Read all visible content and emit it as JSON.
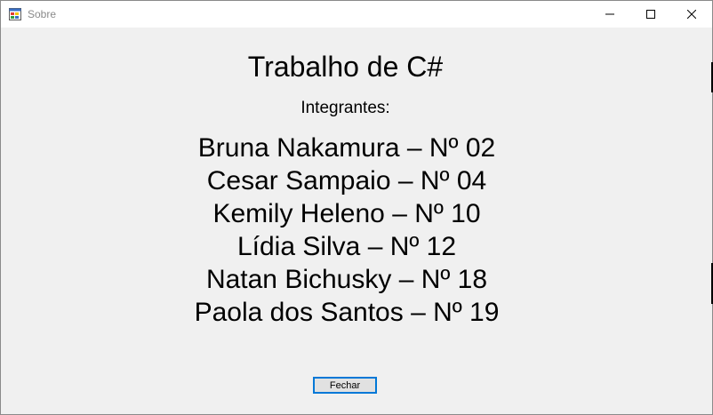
{
  "window": {
    "title": "Sobre",
    "icon": "windows-forms-app-icon"
  },
  "title_controls": {
    "minimize_icon": "minimize-icon",
    "maximize_icon": "maximize-icon",
    "close_icon": "close-icon"
  },
  "content": {
    "heading": "Trabalho de C#",
    "subheading": "Integrantes:",
    "members": [
      "Bruna Nakamura – Nº 02",
      "Cesar Sampaio – Nº 04",
      "Kemily Heleno – Nº 10",
      "Lídia Silva – Nº 12",
      "Natan Bichusky – Nº 18",
      "Paola dos Santos – Nº 19"
    ]
  },
  "buttons": {
    "close_label": "Fechar"
  },
  "colors": {
    "window_background": "#f0f0f0",
    "titlebar_background": "#ffffff",
    "button_focus_border": "#0078d7",
    "button_background": "#e1e1e1"
  }
}
